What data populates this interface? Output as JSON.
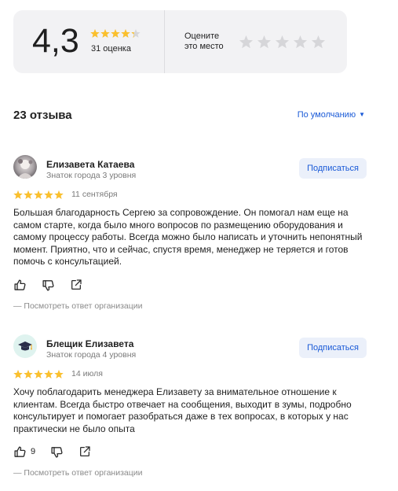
{
  "summary": {
    "rating": "4,3",
    "rating_value": 4.3,
    "count_label": "31 оценка",
    "rate_prompt_line1": "Оцените",
    "rate_prompt_line2": "это место",
    "rate_stars_count": 5
  },
  "reviews_header": {
    "count_label": "23 отзыва",
    "sort_label": "По умолчанию"
  },
  "colors": {
    "star_filled": "#fbc02d",
    "star_empty": "#d6d6d9",
    "accent": "#1a5ad7",
    "card_bg": "#f2f2f4"
  },
  "reviews": [
    {
      "author": "Елизавета Катаева",
      "level": "Знаток города 3 уровня",
      "subscribe_label": "Подписаться",
      "stars": 5,
      "date": "11 сентября",
      "text": "Большая благодарность Сергею за сопровождение. Он помогал нам еще на самом старте, когда было много вопросов по размещению оборудования и самому процессу работы. Всегда можно было написать и уточнить непонятный момент. Приятно, что и сейчас, спустя время, менеджер не теряется и готов помочь с консультацией.",
      "likes": "",
      "org_reply_label": "— Посмотреть ответ организации",
      "avatar": "photo"
    },
    {
      "author": "Блещик Елизавета",
      "level": "Знаток города 4 уровня",
      "subscribe_label": "Подписаться",
      "stars": 5,
      "date": "14 июля",
      "text": "Хочу поблагодарить менеджера Елизавету за внимательное отношение к клиентам. Всегда быстро отвечает на сообщения, выходит в зумы, подробно консультирует и помогает разобраться даже в тех вопросах, в которых у нас практически не было опыта",
      "likes": "9",
      "org_reply_label": "— Посмотреть ответ организации",
      "avatar": "graduation-cap"
    }
  ]
}
